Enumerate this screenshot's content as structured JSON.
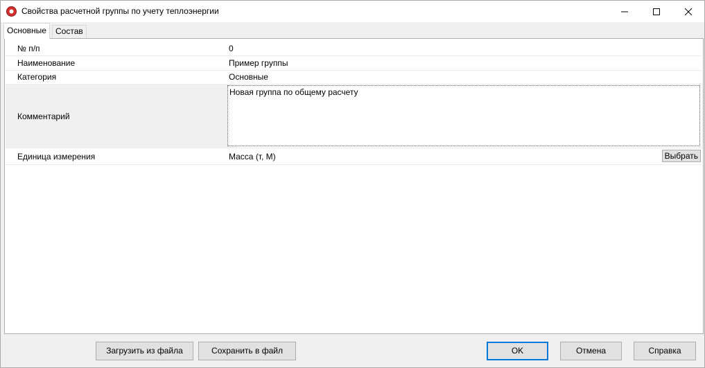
{
  "window": {
    "title": "Свойства расчетной группы по учету теплоэнергии",
    "controls": {
      "minimize_icon": "minimize-icon",
      "maximize_icon": "maximize-icon",
      "close_icon": "close-icon"
    }
  },
  "tabs": [
    {
      "label": "Основные",
      "active": true
    },
    {
      "label": "Состав",
      "active": false
    }
  ],
  "properties": {
    "number": {
      "label": "№ п/п",
      "value": "0"
    },
    "name": {
      "label": "Наименование",
      "value": "Пример группы"
    },
    "category": {
      "label": "Категория",
      "value": "Основные"
    },
    "comment": {
      "label": "Комментарий",
      "value": "Новая группа по общему расчету"
    },
    "unit": {
      "label": "Единица измерения",
      "value": "Масса (т, М)",
      "choose_label": "Выбрать"
    }
  },
  "buttons": {
    "load": "Загрузить из файла",
    "save": "Сохранить в файл",
    "ok": "OK",
    "cancel": "Отмена",
    "help": "Справка"
  },
  "colors": {
    "focus_accent": "#0078d7",
    "app_icon": "#d32f2f"
  }
}
